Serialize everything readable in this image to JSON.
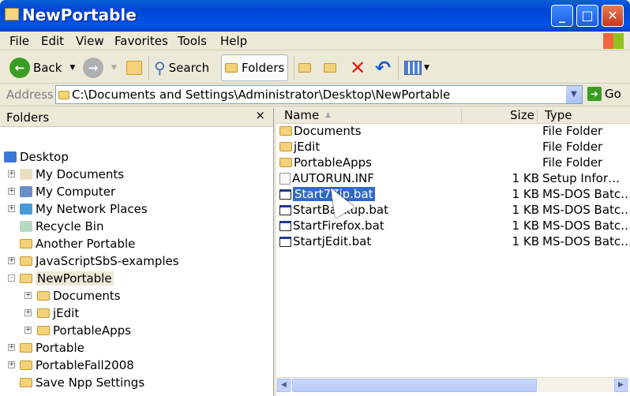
{
  "window": {
    "title": "NewPortable",
    "min": "_",
    "max": "□",
    "close": "✕"
  },
  "menu": [
    "File",
    "Edit",
    "View",
    "Favorites",
    "Tools",
    "Help"
  ],
  "toolbar": {
    "back": "Back",
    "search": "Search",
    "folders": "Folders"
  },
  "address": {
    "label": "Address",
    "value": "C:\\Documents and Settings\\Administrator\\Desktop\\NewPortable",
    "go": "Go"
  },
  "folders_pane": {
    "title": "Folders",
    "close": "×",
    "items": [
      {
        "label": "Desktop"
      },
      {
        "label": "My Documents"
      },
      {
        "label": "My Computer"
      },
      {
        "label": "My Network Places"
      },
      {
        "label": "Recycle Bin"
      },
      {
        "label": "Another Portable"
      },
      {
        "label": "JavaScriptSbS-examples"
      },
      {
        "label": "NewPortable"
      },
      {
        "label": "Documents"
      },
      {
        "label": "jEdit"
      },
      {
        "label": "PortableApps"
      },
      {
        "label": "Portable"
      },
      {
        "label": "PortableFall2008"
      },
      {
        "label": "Save Npp Settings"
      }
    ]
  },
  "list": {
    "columns": {
      "name": "Name",
      "size": "Size",
      "type": "Type"
    },
    "rows": [
      {
        "name": "Documents",
        "size": "",
        "type": "File Folder"
      },
      {
        "name": "jEdit",
        "size": "",
        "type": "File Folder"
      },
      {
        "name": "PortableApps",
        "size": "",
        "type": "File Folder"
      },
      {
        "name": "AUTORUN.INF",
        "size": "1 KB",
        "type": "Setup Infor…"
      },
      {
        "name": "Start7Zip.bat",
        "size": "1 KB",
        "type": "MS-DOS Batc…"
      },
      {
        "name": "StartBackup.bat",
        "size": "1 KB",
        "type": "MS-DOS Batc…"
      },
      {
        "name": "StartFirefox.bat",
        "size": "1 KB",
        "type": "MS-DOS Batc…"
      },
      {
        "name": "StartjEdit.bat",
        "size": "1 KB",
        "type": "MS-DOS Batc…"
      }
    ]
  }
}
